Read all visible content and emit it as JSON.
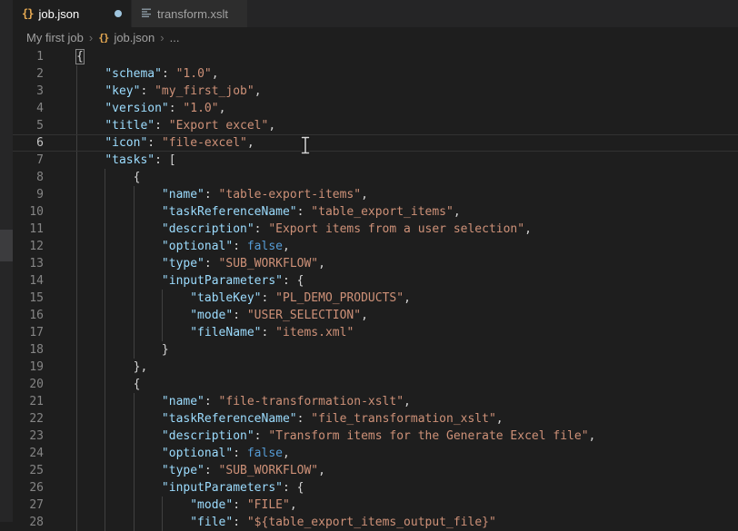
{
  "tabs": [
    {
      "label": "job.json",
      "icon_glyph": "{}",
      "active": true,
      "modified": true
    },
    {
      "label": "transform.xslt",
      "active": false,
      "modified": false
    }
  ],
  "breadcrumb": {
    "items": [
      "My first job",
      "job.json",
      "..."
    ],
    "separator": "›",
    "file_icon_glyph": "{}"
  },
  "colors": {
    "editor_bg": "#1e1e1e",
    "tabbar_bg": "#252526",
    "tab_active_bg": "#1e1e1e",
    "tab_inactive_bg": "#2d2d2d",
    "tab_active_text": "#ffffff",
    "tab_inactive_text": "#a2a2a2",
    "accent_json_icon": "#e8ab53",
    "modified_dot": "#9fc5de",
    "breadcrumb_text": "#a0a0a0",
    "line_number": "#858585",
    "line_number_active": "#c6c6c6",
    "token_key": "#9cdcfe",
    "token_string": "#ce9178",
    "token_keyword": "#569cd6",
    "token_punct": "#d4d4d4",
    "indent_guide": "#404040",
    "current_line_border": "#323232"
  },
  "editor": {
    "current_line": 6,
    "lines": [
      {
        "n": 1,
        "i": 0,
        "t": [
          [
            "pm",
            "{"
          ]
        ]
      },
      {
        "n": 2,
        "i": 1,
        "t": [
          [
            "k",
            "\"schema\""
          ],
          [
            "p",
            ": "
          ],
          [
            "s",
            "\"1.0\""
          ],
          [
            "p",
            ","
          ]
        ]
      },
      {
        "n": 3,
        "i": 1,
        "t": [
          [
            "k",
            "\"key\""
          ],
          [
            "p",
            ": "
          ],
          [
            "s",
            "\"my_first_job\""
          ],
          [
            "p",
            ","
          ]
        ]
      },
      {
        "n": 4,
        "i": 1,
        "t": [
          [
            "k",
            "\"version\""
          ],
          [
            "p",
            ": "
          ],
          [
            "s",
            "\"1.0\""
          ],
          [
            "p",
            ","
          ]
        ]
      },
      {
        "n": 5,
        "i": 1,
        "t": [
          [
            "k",
            "\"title\""
          ],
          [
            "p",
            ": "
          ],
          [
            "s",
            "\"Export excel\""
          ],
          [
            "p",
            ","
          ]
        ]
      },
      {
        "n": 6,
        "i": 1,
        "t": [
          [
            "k",
            "\"icon\""
          ],
          [
            "p",
            ": "
          ],
          [
            "s",
            "\"file-excel\""
          ],
          [
            "p",
            ","
          ]
        ]
      },
      {
        "n": 7,
        "i": 1,
        "t": [
          [
            "k",
            "\"tasks\""
          ],
          [
            "p",
            ": ["
          ]
        ]
      },
      {
        "n": 8,
        "i": 2,
        "t": [
          [
            "p",
            "{"
          ]
        ]
      },
      {
        "n": 9,
        "i": 3,
        "t": [
          [
            "k",
            "\"name\""
          ],
          [
            "p",
            ": "
          ],
          [
            "s",
            "\"table-export-items\""
          ],
          [
            "p",
            ","
          ]
        ]
      },
      {
        "n": 10,
        "i": 3,
        "t": [
          [
            "k",
            "\"taskReferenceName\""
          ],
          [
            "p",
            ": "
          ],
          [
            "s",
            "\"table_export_items\""
          ],
          [
            "p",
            ","
          ]
        ]
      },
      {
        "n": 11,
        "i": 3,
        "t": [
          [
            "k",
            "\"description\""
          ],
          [
            "p",
            ": "
          ],
          [
            "s",
            "\"Export items from a user selection\""
          ],
          [
            "p",
            ","
          ]
        ]
      },
      {
        "n": 12,
        "i": 3,
        "t": [
          [
            "k",
            "\"optional\""
          ],
          [
            "p",
            ": "
          ],
          [
            "b",
            "false"
          ],
          [
            "p",
            ","
          ]
        ]
      },
      {
        "n": 13,
        "i": 3,
        "t": [
          [
            "k",
            "\"type\""
          ],
          [
            "p",
            ": "
          ],
          [
            "s",
            "\"SUB_WORKFLOW\""
          ],
          [
            "p",
            ","
          ]
        ]
      },
      {
        "n": 14,
        "i": 3,
        "t": [
          [
            "k",
            "\"inputParameters\""
          ],
          [
            "p",
            ": {"
          ]
        ]
      },
      {
        "n": 15,
        "i": 4,
        "t": [
          [
            "k",
            "\"tableKey\""
          ],
          [
            "p",
            ": "
          ],
          [
            "s",
            "\"PL_DEMO_PRODUCTS\""
          ],
          [
            "p",
            ","
          ]
        ]
      },
      {
        "n": 16,
        "i": 4,
        "t": [
          [
            "k",
            "\"mode\""
          ],
          [
            "p",
            ": "
          ],
          [
            "s",
            "\"USER_SELECTION\""
          ],
          [
            "p",
            ","
          ]
        ]
      },
      {
        "n": 17,
        "i": 4,
        "t": [
          [
            "k",
            "\"fileName\""
          ],
          [
            "p",
            ": "
          ],
          [
            "s",
            "\"items.xml\""
          ]
        ]
      },
      {
        "n": 18,
        "i": 3,
        "t": [
          [
            "p",
            "}"
          ]
        ]
      },
      {
        "n": 19,
        "i": 2,
        "t": [
          [
            "p",
            "},"
          ]
        ]
      },
      {
        "n": 20,
        "i": 2,
        "t": [
          [
            "p",
            "{"
          ]
        ]
      },
      {
        "n": 21,
        "i": 3,
        "t": [
          [
            "k",
            "\"name\""
          ],
          [
            "p",
            ": "
          ],
          [
            "s",
            "\"file-transformation-xslt\""
          ],
          [
            "p",
            ","
          ]
        ]
      },
      {
        "n": 22,
        "i": 3,
        "t": [
          [
            "k",
            "\"taskReferenceName\""
          ],
          [
            "p",
            ": "
          ],
          [
            "s",
            "\"file_transformation_xslt\""
          ],
          [
            "p",
            ","
          ]
        ]
      },
      {
        "n": 23,
        "i": 3,
        "t": [
          [
            "k",
            "\"description\""
          ],
          [
            "p",
            ": "
          ],
          [
            "s",
            "\"Transform items for the Generate Excel file\""
          ],
          [
            "p",
            ","
          ]
        ]
      },
      {
        "n": 24,
        "i": 3,
        "t": [
          [
            "k",
            "\"optional\""
          ],
          [
            "p",
            ": "
          ],
          [
            "b",
            "false"
          ],
          [
            "p",
            ","
          ]
        ]
      },
      {
        "n": 25,
        "i": 3,
        "t": [
          [
            "k",
            "\"type\""
          ],
          [
            "p",
            ": "
          ],
          [
            "s",
            "\"SUB_WORKFLOW\""
          ],
          [
            "p",
            ","
          ]
        ]
      },
      {
        "n": 26,
        "i": 3,
        "t": [
          [
            "k",
            "\"inputParameters\""
          ],
          [
            "p",
            ": {"
          ]
        ]
      },
      {
        "n": 27,
        "i": 4,
        "t": [
          [
            "k",
            "\"mode\""
          ],
          [
            "p",
            ": "
          ],
          [
            "s",
            "\"FILE\""
          ],
          [
            "p",
            ","
          ]
        ]
      },
      {
        "n": 28,
        "i": 4,
        "t": [
          [
            "k",
            "\"file\""
          ],
          [
            "p",
            ": "
          ],
          [
            "s",
            "\"${table_export_items_output_file}\""
          ]
        ]
      }
    ]
  }
}
